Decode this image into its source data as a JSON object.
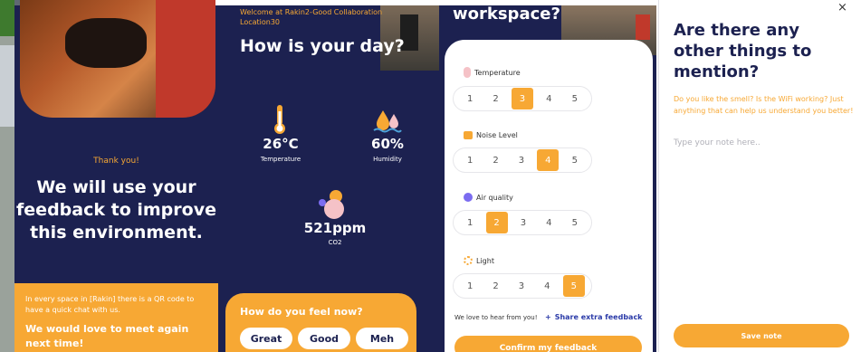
{
  "thanks": {
    "small": "Thank you!",
    "line1": "We will use your",
    "line2": "feedback to improve",
    "line3": "this environment.",
    "qr_info": "In every space in [Rakin] there is a QR code to have a quick chat with us.",
    "meet_again": "We would love to meet again next time!"
  },
  "dashboard": {
    "welcome": "Welcome at Rakin2-Good Collaboration",
    "location": "Location30",
    "greeting": "How is your day?",
    "temperature": {
      "value": "26°C",
      "label": "Temperature"
    },
    "humidity": {
      "value": "60%",
      "label": "Humidity"
    },
    "co2": {
      "value": "521ppm",
      "label": "CO2"
    },
    "mood_question": "How do you feel now?",
    "moods": [
      "Great",
      "Good",
      "Meh"
    ]
  },
  "workspace": {
    "title": "workspace?",
    "metrics": [
      {
        "label": "Temperature",
        "selected": 3
      },
      {
        "label": "Noise Level",
        "selected": 4
      },
      {
        "label": "Air quality",
        "selected": 2
      },
      {
        "label": "Light",
        "selected": 5
      }
    ],
    "scale": [
      "1",
      "2",
      "3",
      "4",
      "5"
    ],
    "hear_from_you": "We love to hear from you!",
    "share_feedback": "Share extra feedback",
    "confirm": "Confirm my feedback"
  },
  "note": {
    "close": "×",
    "title1": "Are there any",
    "title2": "other things to",
    "title3": "mention?",
    "hint": "Do you like the smell? Is the WiFi working? Just anything that can help us understand you better!",
    "placeholder": "Type your note here..",
    "save": "Save note"
  },
  "colors": {
    "navy": "#1c2150",
    "accent": "#f7a834"
  }
}
